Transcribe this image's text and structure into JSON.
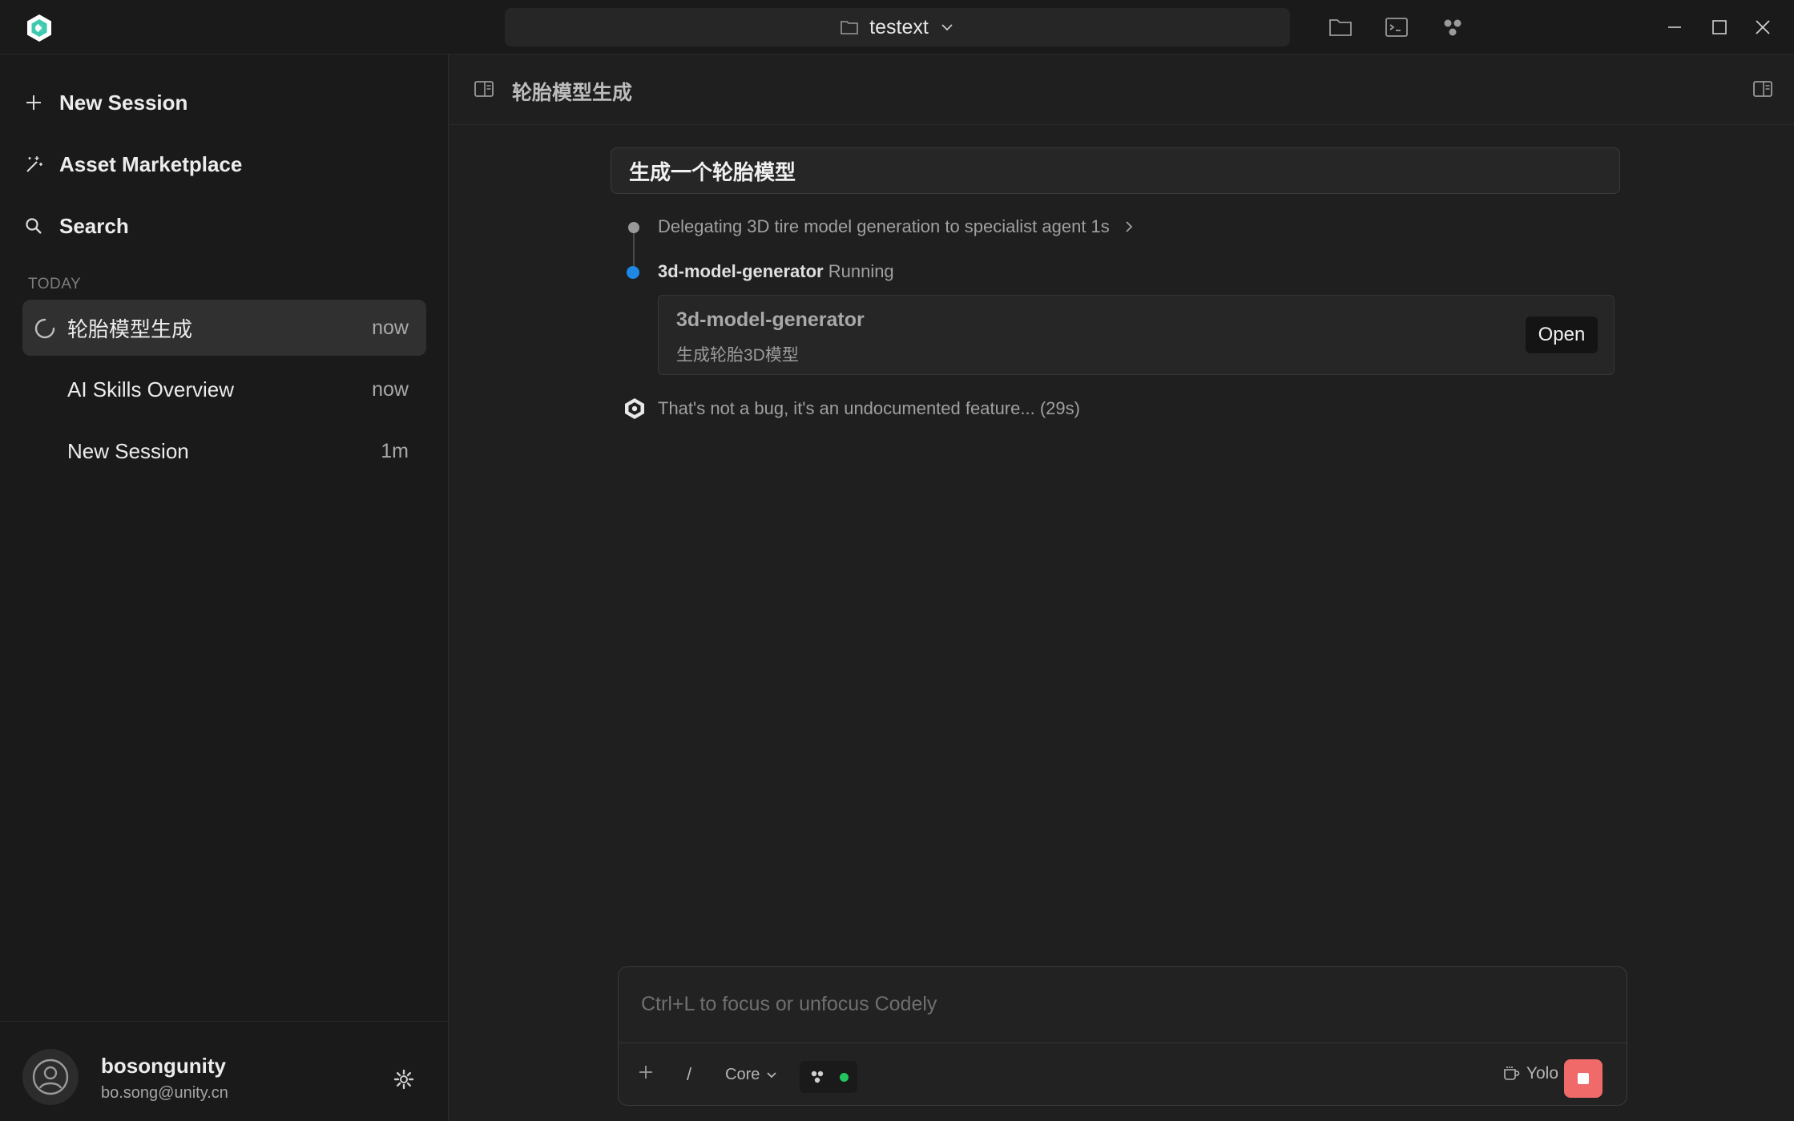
{
  "titlebar": {
    "workspace_name": "testext",
    "icons": [
      "app-logo-icon",
      "folder-icon",
      "terminal-icon",
      "agents-icon",
      "minimize-icon",
      "maximize-icon",
      "close-icon"
    ]
  },
  "sidebar": {
    "nav": [
      {
        "label": "New Session",
        "icon": "plus-icon"
      },
      {
        "label": "Asset Marketplace",
        "icon": "magic-wand-icon"
      },
      {
        "label": "Search",
        "icon": "search-icon"
      }
    ],
    "section_label": "TODAY",
    "sessions": [
      {
        "title": "轮胎模型生成",
        "time": "now",
        "active": true,
        "loading": true
      },
      {
        "title": "AI Skills Overview",
        "time": "now",
        "active": false
      },
      {
        "title": "New Session",
        "time": "1m",
        "active": false
      }
    ],
    "user": {
      "name": "bosongunity",
      "email": "bo.song@unity.cn"
    }
  },
  "main": {
    "session_title": "轮胎模型生成",
    "user_message": "生成一个轮胎模型",
    "steps": [
      {
        "text": "Delegating 3D tire model generation to specialist agent 1s"
      },
      {
        "agent": "3d-model-generator",
        "status": "Running"
      }
    ],
    "agent_card": {
      "title": "3d-model-generator",
      "subtitle": "生成轮胎3D模型",
      "button": "Open"
    },
    "status_text": "That's not a bug, it's an undocumented feature... (29s)"
  },
  "composer": {
    "placeholder": "Ctrl+L to focus or unfocus Codely",
    "slash": "/",
    "model": "Core",
    "mode": "Yolo"
  },
  "colors": {
    "accent_blue": "#1e88e5",
    "status_green": "#22c55e",
    "stop_red": "#f06a6a",
    "logo_teal": "#3ec9b0"
  }
}
